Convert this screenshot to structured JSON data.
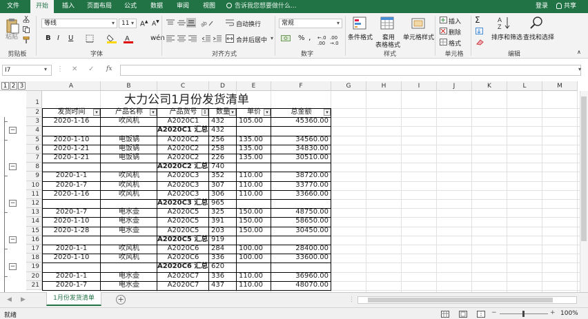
{
  "tabs": [
    "文件",
    "开始",
    "插入",
    "页面布局",
    "公式",
    "数据",
    "审阅",
    "视图"
  ],
  "tell_me": "告诉我您想要做什么...",
  "login": "登录",
  "share": "共享",
  "ribbon": {
    "paste": "粘贴",
    "clipboard": "剪贴板",
    "font_name": "等线",
    "font_size": "11",
    "bold": "B",
    "italic": "I",
    "underline": "U",
    "font_group": "字体",
    "wrap": "自动换行",
    "merge": "合并后居中",
    "align_group": "对齐方式",
    "num_format": "常规",
    "num_group": "数字",
    "percent": "%",
    "comma": ",",
    "cond_format": "条件格式",
    "table_format_1": "套用",
    "table_format_2": "表格格式",
    "cell_style": "单元格样式",
    "style_group": "样式",
    "insert": "插入",
    "delete": "删除",
    "format": "格式",
    "cells_group": "单元格",
    "sort_filter": "排序和筛选",
    "find_select": "查找和选择",
    "edit_group": "编辑"
  },
  "formula_bar": {
    "name_box": "I7",
    "fx": "fx",
    "content": ""
  },
  "outline_levels": [
    "1",
    "2",
    "3"
  ],
  "columns": [
    "A",
    "B",
    "C",
    "D",
    "E",
    "F",
    "G",
    "H",
    "I",
    "J",
    "K",
    "L",
    "M"
  ],
  "title": "大力公司1月份发货清单",
  "headers": [
    "发货时间",
    "产品名称",
    "产品货号",
    "数量",
    "单价",
    "总金额"
  ],
  "rows": [
    {
      "n": "3",
      "a": "2020-1-16",
      "b": "吹风机",
      "c": "A2020C1",
      "d": "432",
      "e": "105.00",
      "f": "45360.00",
      "sub": false
    },
    {
      "n": "4",
      "a": "",
      "b": "",
      "c": "A2020C1 汇总",
      "d": "432",
      "e": "",
      "f": "",
      "sub": true
    },
    {
      "n": "5",
      "a": "2020-1-10",
      "b": "电饭锅",
      "c": "A2020C2",
      "d": "256",
      "e": "135.00",
      "f": "34560.00",
      "sub": false
    },
    {
      "n": "6",
      "a": "2020-1-21",
      "b": "电饭锅",
      "c": "A2020C2",
      "d": "258",
      "e": "135.00",
      "f": "34830.00",
      "sub": false
    },
    {
      "n": "7",
      "a": "2020-1-21",
      "b": "电饭锅",
      "c": "A2020C2",
      "d": "226",
      "e": "135.00",
      "f": "30510.00",
      "sub": false
    },
    {
      "n": "8",
      "a": "",
      "b": "",
      "c": "A2020C2 汇总",
      "d": "740",
      "e": "",
      "f": "",
      "sub": true
    },
    {
      "n": "9",
      "a": "2020-1-1",
      "b": "吹风机",
      "c": "A2020C3",
      "d": "352",
      "e": "110.00",
      "f": "38720.00",
      "sub": false
    },
    {
      "n": "10",
      "a": "2020-1-7",
      "b": "吹风机",
      "c": "A2020C3",
      "d": "307",
      "e": "110.00",
      "f": "33770.00",
      "sub": false
    },
    {
      "n": "11",
      "a": "2020-1-16",
      "b": "吹风机",
      "c": "A2020C3",
      "d": "306",
      "e": "110.00",
      "f": "33660.00",
      "sub": false
    },
    {
      "n": "12",
      "a": "",
      "b": "",
      "c": "A2020C3 汇总",
      "d": "965",
      "e": "",
      "f": "",
      "sub": true
    },
    {
      "n": "13",
      "a": "2020-1-7",
      "b": "电水壶",
      "c": "A2020C5",
      "d": "325",
      "e": "150.00",
      "f": "48750.00",
      "sub": false
    },
    {
      "n": "14",
      "a": "2020-1-10",
      "b": "电水壶",
      "c": "A2020C5",
      "d": "391",
      "e": "150.00",
      "f": "58650.00",
      "sub": false
    },
    {
      "n": "15",
      "a": "2020-1-28",
      "b": "电水壶",
      "c": "A2020C5",
      "d": "203",
      "e": "150.00",
      "f": "30450.00",
      "sub": false
    },
    {
      "n": "16",
      "a": "",
      "b": "",
      "c": "A2020C5 汇总",
      "d": "919",
      "e": "",
      "f": "",
      "sub": true
    },
    {
      "n": "17",
      "a": "2020-1-1",
      "b": "吹风机",
      "c": "A2020C6",
      "d": "284",
      "e": "100.00",
      "f": "28400.00",
      "sub": false
    },
    {
      "n": "18",
      "a": "2020-1-10",
      "b": "吹风机",
      "c": "A2020C6",
      "d": "336",
      "e": "100.00",
      "f": "33600.00",
      "sub": false
    },
    {
      "n": "19",
      "a": "",
      "b": "",
      "c": "A2020C6 汇总",
      "d": "620",
      "e": "",
      "f": "",
      "sub": true
    },
    {
      "n": "20",
      "a": "2020-1-1",
      "b": "电水壶",
      "c": "A2020C7",
      "d": "336",
      "e": "110.00",
      "f": "36960.00",
      "sub": false
    },
    {
      "n": "21",
      "a": "2020-1-7",
      "b": "电水壶",
      "c": "A2020C7",
      "d": "437",
      "e": "110.00",
      "f": "48070.00",
      "sub": false
    }
  ],
  "sheet_tab": "1月份发货清单",
  "status": "就绪",
  "zoom": "100%",
  "colors": {
    "excel_green": "#217346",
    "ribbon": "#f3f3f3"
  }
}
